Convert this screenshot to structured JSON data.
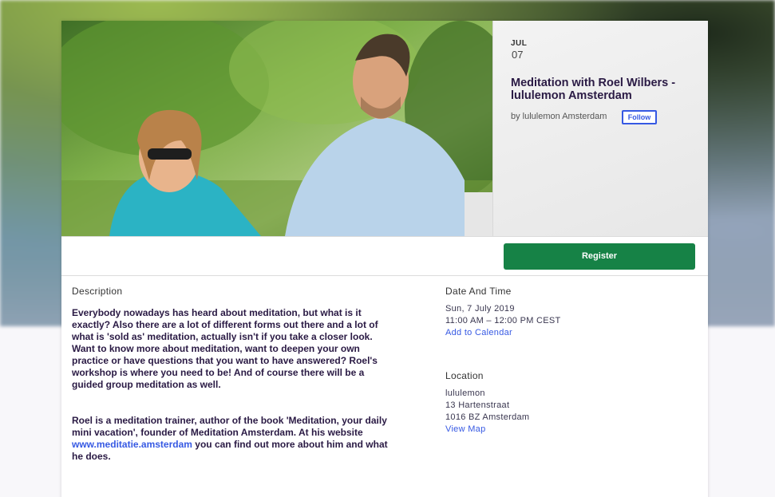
{
  "event": {
    "month": "JUL",
    "day": "07",
    "title": "Meditation with Roel Wilbers - lululemon Amsterdam",
    "organizer": "by lululemon Amsterdam",
    "follow_label": "Follow"
  },
  "actions": {
    "register_label": "Register"
  },
  "description": {
    "heading": "Description",
    "paragraph1": "Everybody nowadays has heard about meditation, but what is it exactly? Also there are a lot of different forms out there and a lot of what is 'sold as' meditation, actually isn't if you take a closer look. Want to know more about meditation, want to deepen your own practice or have questions that you want to have answered? Roel's workshop is where you need to be! And of course there will be a guided group meditation as well.",
    "paragraph2_before": "Roel is a meditation trainer, author of the book 'Meditation, your daily mini vacation', founder of Meditation Amsterdam. At his website ",
    "paragraph2_link": "www.meditatie.amsterdam",
    "paragraph2_after": " you can find out more about him and what he does."
  },
  "date_time": {
    "heading": "Date And Time",
    "date": "Sun, 7 July 2019",
    "time": "11:00 AM – 12:00 PM CEST",
    "calendar_link": "Add to Calendar"
  },
  "location": {
    "heading": "Location",
    "venue": "lululemon",
    "street": "13 Hartenstraat",
    "city": "1016 BZ Amsterdam",
    "map_link": "View Map"
  },
  "colors": {
    "register": "#168246",
    "link": "#3659e3",
    "title": "#2a1a44"
  }
}
